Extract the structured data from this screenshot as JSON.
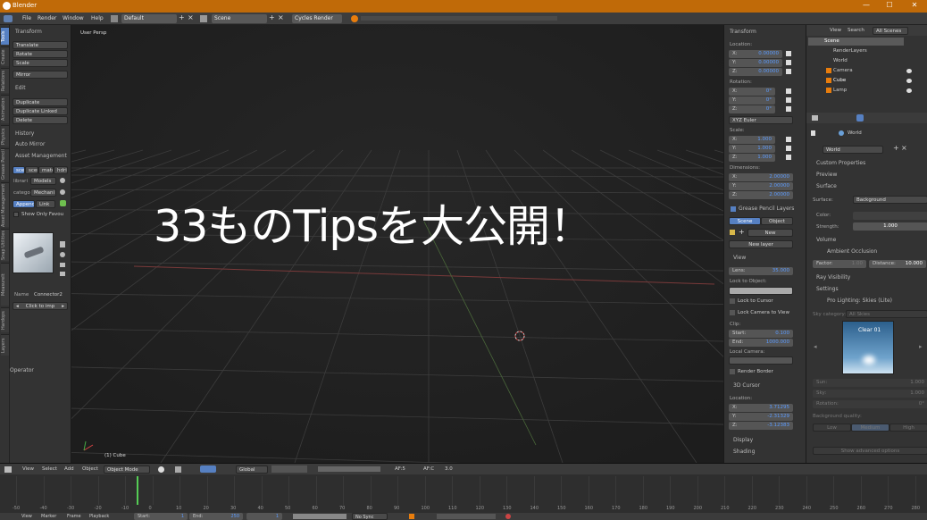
{
  "app": {
    "title": "Blender",
    "title_info": "Cycles Render",
    "win_min": "—",
    "win_max": "☐",
    "win_close": "✕"
  },
  "menu": {
    "items": [
      "File",
      "Render",
      "Window",
      "Help"
    ],
    "screen_layout": "Default",
    "scene": "Scene",
    "engine": "Cycles Render"
  },
  "lefttabs": [
    "Tools",
    "Create",
    "Relations",
    "Animation",
    "Physics",
    "Grease Pencil",
    "Asset Management",
    "Snap Utilities",
    "MeasureIt",
    "Hardops",
    "Layers"
  ],
  "tool": {
    "transform": "Transform",
    "translate": "Translate",
    "rotate": "Rotate",
    "scale": "Scale",
    "mirror": "Mirror",
    "edit": "Edit",
    "duplicate": "Duplicate",
    "duplicate_linked": "Duplicate Linked",
    "delete": "Delete",
    "history": "History",
    "auto_mirror": "Auto Mirror",
    "asset": "Asset Management",
    "tabs": [
      "scen",
      "scen",
      "mate",
      "hdri"
    ],
    "library": "librari",
    "library_val": "Models",
    "category": "catego",
    "category_val": "Mechani",
    "append": "Append",
    "link": "Link",
    "show_only": "Show Only Favou",
    "name_label": "Name",
    "name_val": "Connector2",
    "click_to_imp": "Click to imp",
    "operator": "Operator"
  },
  "viewport": {
    "label": "User Persp",
    "object": "(1) Cube",
    "overlay": "33ものTipsを大公開！"
  },
  "props": {
    "transform": "Transform",
    "location": "Location:",
    "loc": [
      [
        "X:",
        "0.00000"
      ],
      [
        "Y:",
        "0.00000"
      ],
      [
        "Z:",
        "0.00000"
      ]
    ],
    "rotation": "Rotation:",
    "rot": [
      [
        "X:",
        "0°"
      ],
      [
        "Y:",
        "0°"
      ],
      [
        "Z:",
        "0°"
      ]
    ],
    "euler": "XYZ Euler",
    "scale": "Scale:",
    "scl": [
      [
        "X:",
        "1.000"
      ],
      [
        "Y:",
        "1.000"
      ],
      [
        "Z:",
        "1.000"
      ]
    ],
    "dimensions": "Dimensions:",
    "dim": [
      [
        "X:",
        "2.00000"
      ],
      [
        "Y:",
        "2.00000"
      ],
      [
        "Z:",
        "2.00000"
      ]
    ],
    "gp_layers": "Grease Pencil Layers",
    "gp_scene": "Scene",
    "gp_object": "Object",
    "gp_new": "New",
    "gp_newlayer": "New layer",
    "view": "View",
    "lens_l": "Lens:",
    "lens_v": "35.000",
    "lock": "Lock to Object:",
    "lock_cursor": "Lock to Cursor",
    "lock_camera": "Lock Camera to View",
    "clip": "Clip:",
    "start_l": "Start:",
    "start_v": "0.100",
    "end_l": "End:",
    "end_v": "1000.000",
    "local_camera": "Local Camera:",
    "render_border": "Render Border",
    "cursor": "3D Cursor",
    "cursor_loc": "Location:",
    "cur": [
      [
        "X:",
        "3.71295"
      ],
      [
        "Y:",
        "-2.31329"
      ],
      [
        "Z:",
        "-3.12383"
      ]
    ],
    "display": "Display",
    "shading": "Shading"
  },
  "outliner": {
    "view": "View",
    "search": "Search",
    "all_scenes": "All Scenes",
    "items": [
      "Scene",
      "RenderLayers",
      "World",
      "Camera",
      "Cube",
      "Lamp"
    ]
  },
  "world": {
    "world_label": "World",
    "world_name": "World",
    "custom_props": "Custom Properties",
    "preview": "Preview",
    "surface": "Surface",
    "surface_l": "Surface:",
    "surface_v": "Background",
    "color_l": "Color:",
    "strength_l": "Strength:",
    "strength_v": "1.000",
    "volume": "Volume",
    "ao": "Ambient Occlusion",
    "factor_l": "Factor:",
    "factor_v": "1.00",
    "distance_l": "Distance:",
    "distance_v": "10.000",
    "ray_vis": "Ray Visibility",
    "settings": "Settings",
    "pro_lighting": "Pro Lighting: Skies (Lite)",
    "sky_cat": "Sky category:",
    "sky_cat_v": "All Skies",
    "thumb": "Clear 01",
    "sun": "Sun:",
    "sun_v": "1.000",
    "sky": "Sky:",
    "sky_v": "1.000",
    "rotation": "Rotation:",
    "rotation_v": "0°",
    "bg_quality": "Background quality:",
    "q_low": "Low",
    "q_med": "Medium",
    "q_high": "High",
    "show_adv": "Show advanced options"
  },
  "header3d": {
    "view": "View",
    "select": "Select",
    "add": "Add",
    "object": "Object",
    "mode": "Object Mode",
    "pivot": "Global",
    "af5": "AF:5",
    "afc": "AF:C",
    "ver": "3.0"
  },
  "timeline": {
    "ticks": [
      "-50",
      "-40",
      "-30",
      "-20",
      "-10",
      "0",
      "10",
      "20",
      "30",
      "40",
      "50",
      "60",
      "70",
      "80",
      "90",
      "100",
      "110",
      "120",
      "130",
      "140",
      "150",
      "160",
      "170",
      "180",
      "190",
      "200",
      "210",
      "220",
      "230",
      "240",
      "250",
      "260",
      "270",
      "280"
    ],
    "footer": [
      "View",
      "Marker",
      "Frame",
      "Playback"
    ],
    "start_l": "Start:",
    "start_v": "1",
    "end_l": "End:",
    "end_v": "250",
    "cur": "1",
    "nosync": "No Sync"
  }
}
